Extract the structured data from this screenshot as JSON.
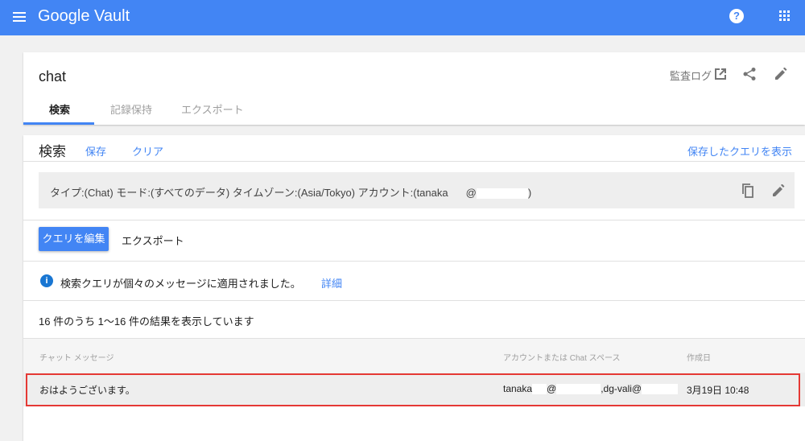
{
  "app": {
    "title": "Google Vault"
  },
  "matter": {
    "title": "chat",
    "audit_log": "監査ログ",
    "tabs": [
      {
        "label": "検索"
      },
      {
        "label": "記録保持"
      },
      {
        "label": "エクスポート"
      }
    ]
  },
  "search": {
    "title": "検索",
    "save": "保存",
    "clear": "クリア",
    "show_saved": "保存したクエリを表示",
    "query_summary": "タイプ:(Chat) モード:(すべてのデータ) タイムゾーン:(Asia/Tokyo) アカウント:(tanaka",
    "query_at": "@",
    "query_end": ")",
    "edit_query": "クエリを編集",
    "export": "エクスポート",
    "info_text": "検索クエリが個々のメッセージに適用されました。",
    "info_link": "詳細",
    "result_count": "16 件のうち 1～16 件の結果を表示しています"
  },
  "table": {
    "headers": [
      "チャット メッセージ",
      "アカウントまたは Chat スペース",
      "作成日"
    ],
    "rows": [
      {
        "message": "おはようございます。",
        "account_a": "tanaka",
        "account_at": "@",
        "account_b": ",dg-vali@",
        "date": "3月19日 10:48"
      }
    ]
  },
  "colors": {
    "brand": "#4285f4",
    "highlight": "#e53935"
  }
}
